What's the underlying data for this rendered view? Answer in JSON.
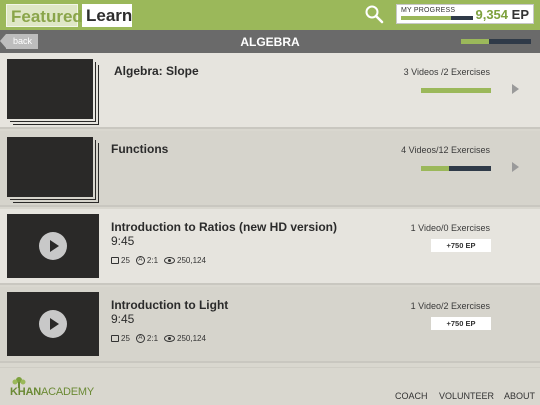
{
  "nav": {
    "tab_featured": "Featured",
    "tab_learn": "Learn",
    "search_icon": "search-icon"
  },
  "progress": {
    "label": "MY PROGRESS",
    "points": "9,354",
    "unit": "EP",
    "fill_fraction": 0.7
  },
  "section": {
    "back_label": "back",
    "title": "ALGEBRA",
    "progress_fraction": 0.4
  },
  "rows": [
    {
      "kind": "playlist",
      "title": "Algebra: Slope",
      "meta": "3 Videos /2 Exercises",
      "progress_fraction": 1.0
    },
    {
      "kind": "playlist",
      "title": "Functions",
      "meta": "4 Videos/12 Exercises",
      "progress_fraction": 0.4
    },
    {
      "kind": "video",
      "title": "Introduction to Ratios (new HD version)",
      "duration": "9:45",
      "meta": "1 Video/0 Exercises",
      "ep_reward": "+750",
      "ep_unit": "EP",
      "comments": "25",
      "answers": "2:1",
      "views": "250,124"
    },
    {
      "kind": "video",
      "title": "Introduction to Light",
      "duration": "9:45",
      "meta": "1 Video/2 Exercises",
      "ep_reward": "+750",
      "ep_unit": "EP",
      "comments": "25",
      "answers": "2:1",
      "views": "250,124"
    }
  ],
  "footer": {
    "logo_bold": "KHAN",
    "logo_thin": "ACADEMY",
    "links": [
      "COACH",
      "VOLUNTEER",
      "ABOUT"
    ]
  },
  "colors": {
    "accent_green": "#9bb85a",
    "dark_track": "#2f3a48"
  }
}
